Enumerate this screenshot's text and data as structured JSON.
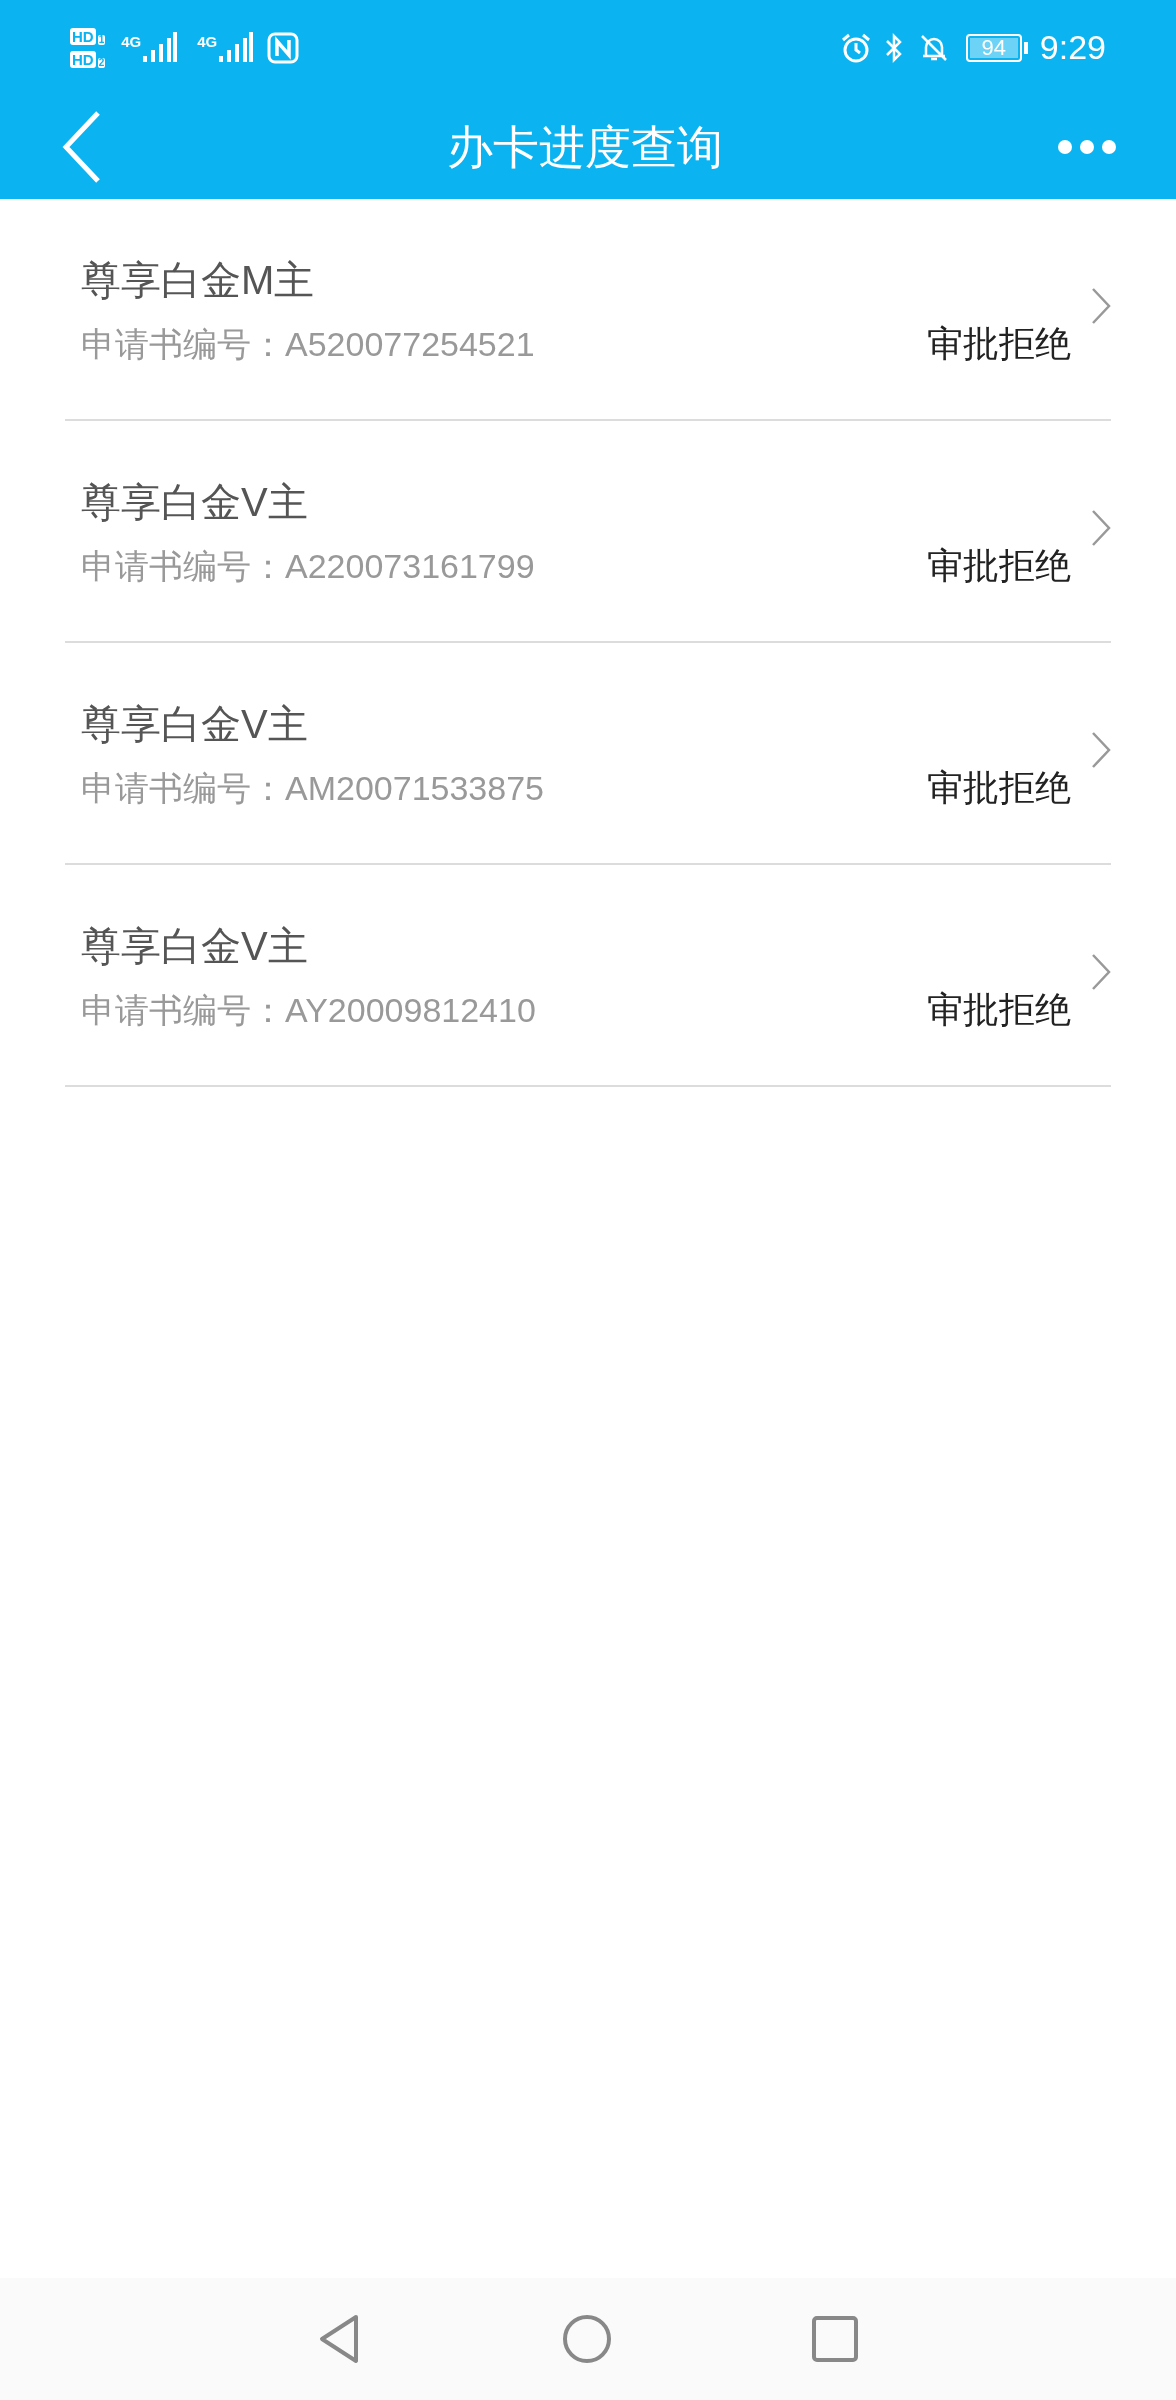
{
  "status_bar": {
    "sim_badges": [
      {
        "label": "HD",
        "slot": "1"
      },
      {
        "label": "HD",
        "slot": "2"
      }
    ],
    "networks": [
      "4G",
      "4G"
    ],
    "battery": "94",
    "time": "9:29"
  },
  "header": {
    "title": "办卡进度查询"
  },
  "applications": [
    {
      "card": "尊享白金M主",
      "number_label": "申请书编号：",
      "number": "A520077254521",
      "status": "审批拒绝"
    },
    {
      "card": "尊享白金V主",
      "number_label": "申请书编号：",
      "number": "A220073161799",
      "status": "审批拒绝"
    },
    {
      "card": "尊享白金V主",
      "number_label": "申请书编号：",
      "number": "AM20071533875",
      "status": "审批拒绝"
    },
    {
      "card": "尊享白金V主",
      "number_label": "申请书编号：",
      "number": "AY20009812410",
      "status": "审批拒绝"
    }
  ]
}
